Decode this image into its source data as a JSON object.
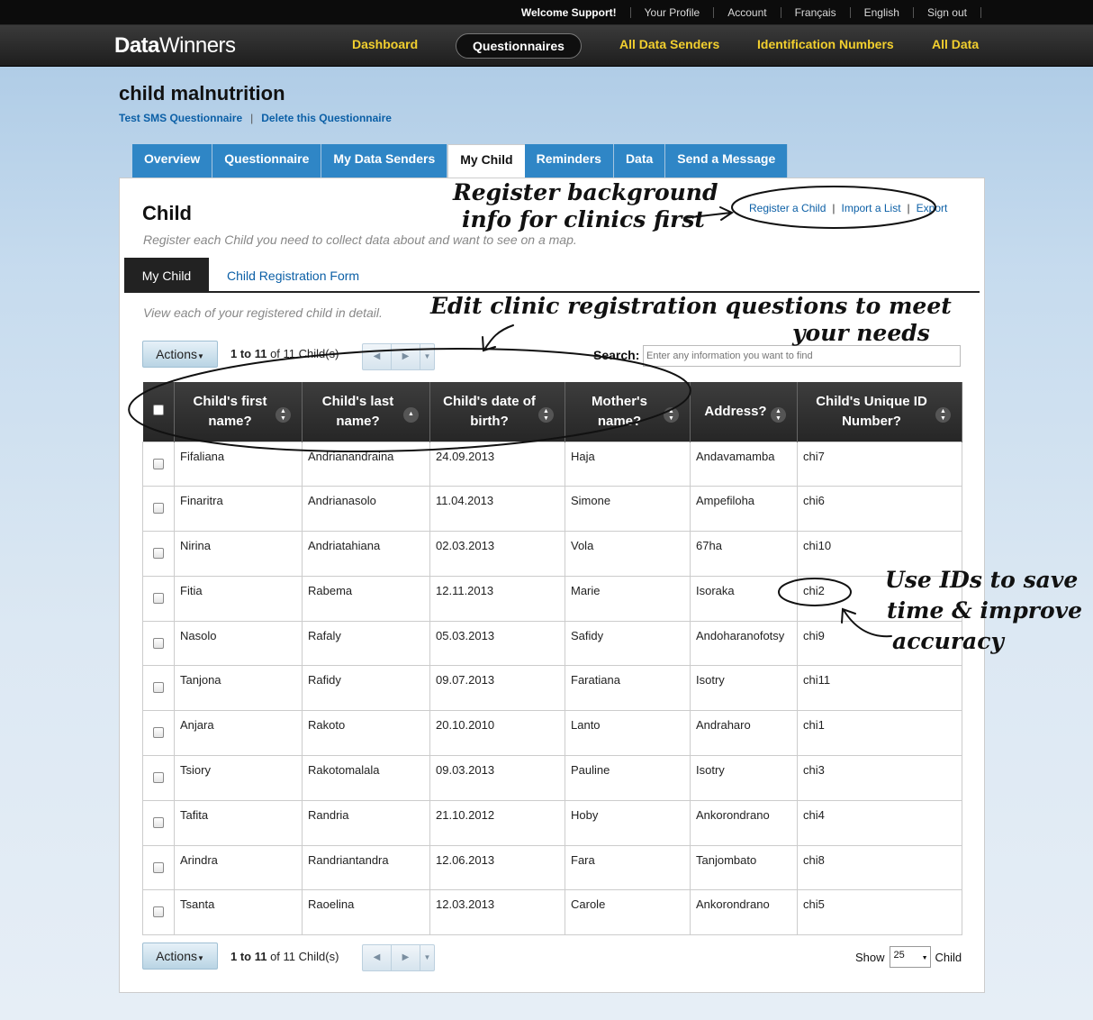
{
  "topbar": {
    "links": [
      "Welcome Support!",
      "Your Profile",
      "Account",
      "Français",
      "English",
      "Sign out"
    ]
  },
  "logo": {
    "bold": "Data",
    "light": "Winners"
  },
  "nav": {
    "dashboard": "Dashboard",
    "questionnaires": "Questionnaires",
    "data_senders": "All Data Senders",
    "id_numbers": "Identification Numbers",
    "all_data": "All Data"
  },
  "project": {
    "title": "child malnutrition",
    "test_link": "Test SMS Questionnaire",
    "delete_link": "Delete this Questionnaire"
  },
  "tabs": [
    "Overview",
    "Questionnaire",
    "My Data Senders",
    "My Child",
    "Reminders",
    "Data",
    "Send a Message"
  ],
  "panel": {
    "title": "Child",
    "description": "Register each Child you need to collect data about and want to see on a map.",
    "register_link": "Register a Child",
    "import_link": "Import a List",
    "export_link": "Export",
    "subtab_active": "My Child",
    "subtab_form": "Child Registration Form",
    "view_desc": "View each of your registered child in detail."
  },
  "toolbar": {
    "actions": "Actions",
    "count_from": "1 to 11",
    "count_rest": " of 11 Child(s)",
    "search_label": "Search:",
    "search_placeholder": "Enter any information you want to find"
  },
  "grid": {
    "headers": [
      "Child's first name?",
      "Child's last name?",
      "Child's date of birth?",
      "Mother's name?",
      "Address?",
      "Child's Unique ID Number?"
    ],
    "rows": [
      [
        "Fifaliana",
        "Andrianandraina",
        "24.09.2013",
        "Haja",
        "Andavamamba",
        "chi7"
      ],
      [
        "Finaritra",
        "Andrianasolo",
        "11.04.2013",
        "Simone",
        "Ampefiloha",
        "chi6"
      ],
      [
        "Nirina",
        "Andriatahiana",
        "02.03.2013",
        "Vola",
        "67ha",
        "chi10"
      ],
      [
        "Fitia",
        "Rabema",
        "12.11.2013",
        "Marie",
        "Isoraka",
        "chi2"
      ],
      [
        "Nasolo",
        "Rafaly",
        "05.03.2013",
        "Safidy",
        "Andoharanofotsy",
        "chi9"
      ],
      [
        "Tanjona",
        "Rafidy",
        "09.07.2013",
        "Faratiana",
        "Isotry",
        "chi11"
      ],
      [
        "Anjara",
        "Rakoto",
        "20.10.2010",
        "Lanto",
        "Andraharo",
        "chi1"
      ],
      [
        "Tsiory",
        "Rakotomalala",
        "09.03.2013",
        "Pauline",
        "Isotry",
        "chi3"
      ],
      [
        "Tafita",
        "Randria",
        "21.10.2012",
        "Hoby",
        "Ankorondrano",
        "chi4"
      ],
      [
        "Arindra",
        "Randriantandra",
        "12.06.2013",
        "Fara",
        "Tanjombato",
        "chi8"
      ],
      [
        "Tsanta",
        "Raoelina",
        "12.03.2013",
        "Carole",
        "Ankorondrano",
        "chi5"
      ]
    ]
  },
  "footer": {
    "show_label": "Show",
    "show_value": "25",
    "show_unit": "Child"
  },
  "annotations": {
    "register_note": [
      "Register background",
      "info for clinics first"
    ],
    "edit_note": [
      "Edit clinic registration questions to meet",
      "your needs"
    ],
    "ids_note": [
      "Use IDs to save",
      "time & improve",
      "accuracy"
    ]
  }
}
